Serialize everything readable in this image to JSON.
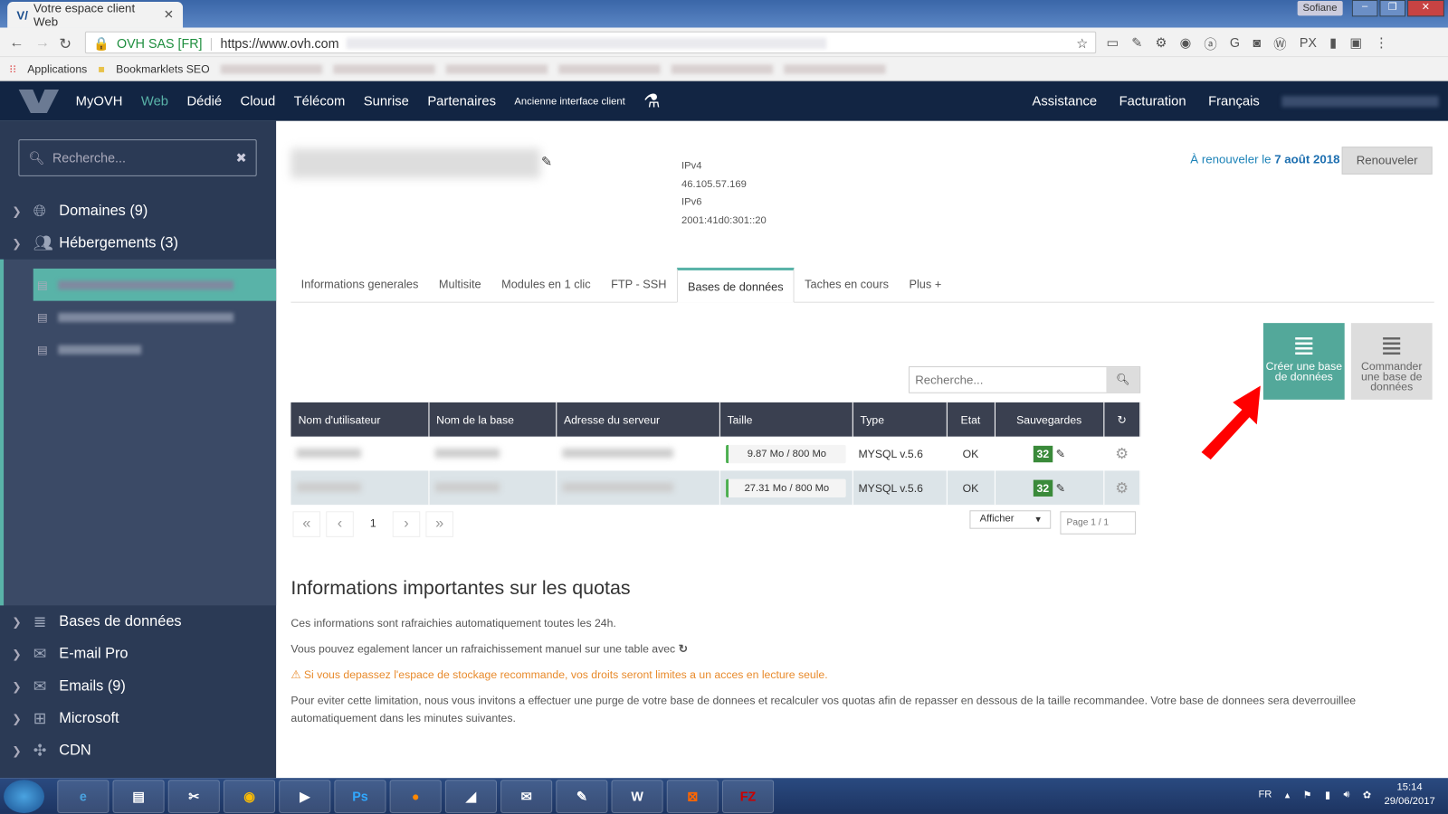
{
  "browser": {
    "tab_title": "Votre espace client Web",
    "user": "Sofiane",
    "security": "OVH SAS [FR]",
    "url": "https://www.ovh.com",
    "bookmarks": [
      "Applications",
      "Bookmarklets SEO"
    ]
  },
  "topnav": {
    "items": [
      "MyOVH",
      "Web",
      "Dédié",
      "Cloud",
      "Télécom",
      "Sunrise",
      "Partenaires"
    ],
    "active": "Web",
    "legacy": "Ancienne interface client",
    "right": [
      "Assistance",
      "Facturation",
      "Français"
    ]
  },
  "sidebar": {
    "search_placeholder": "Recherche...",
    "items": [
      "Domaines (9)",
      "Hébergements (3)",
      "Bases de données",
      "E-mail Pro",
      "Emails (9)",
      "Microsoft",
      "CDN"
    ]
  },
  "main": {
    "ip": {
      "v4_label": "IPv4",
      "v4": "46.105.57.169",
      "v6_label": "IPv6",
      "v6": "2001:41d0:301::20"
    },
    "renew": {
      "prefix": "À renouveler le",
      "date": "7 août 2018",
      "button": "Renouveler"
    },
    "tabs": [
      "Informations generales",
      "Multisite",
      "Modules en 1 clic",
      "FTP - SSH",
      "Bases de données",
      "Taches en cours",
      "Plus +"
    ],
    "active_tab": "Bases de données",
    "actions": {
      "create": "Créer une base de données",
      "order": "Commander une base de données"
    },
    "table_search_placeholder": "Recherche...",
    "columns": [
      "Nom d'utilisateur",
      "Nom de la base",
      "Adresse du serveur",
      "Taille",
      "Type",
      "Etat",
      "Sauvegardes"
    ],
    "rows": [
      {
        "size": "9.87 Mo / 800 Mo",
        "type": "MYSQL v.5.6",
        "state": "OK",
        "backups": "32"
      },
      {
        "size": "27.31 Mo / 800 Mo",
        "type": "MYSQL v.5.6",
        "state": "OK",
        "backups": "32"
      }
    ],
    "pager": {
      "page": "1",
      "show": "Afficher",
      "page_of": "Page 1 / 1"
    },
    "quota": {
      "title": "Informations importantes sur les quotas",
      "p1": "Ces informations sont rafraichies automatiquement toutes les 24h.",
      "p2": "Vous pouvez egalement lancer un rafraichissement manuel sur une table avec",
      "warn": "Si vous depassez l'espace de stockage recommande, vos droits seront limites a un acces en lecture seule.",
      "p3": "Pour eviter cette limitation, nous vous invitons a effectuer une purge de votre base de donnees et recalculer vos quotas afin de repasser en dessous de la taille recommandee. Votre base de donnees sera deverrouillee automatiquement dans les minutes suivantes."
    }
  },
  "taskbar": {
    "lang": "FR",
    "time": "15:14",
    "date": "29/06/2017"
  },
  "colors": {
    "accent": "#59b3a8",
    "nav": "#122543",
    "sidebar": "#2b3a55",
    "warning": "#e88a2b",
    "link": "#1d83b8"
  }
}
